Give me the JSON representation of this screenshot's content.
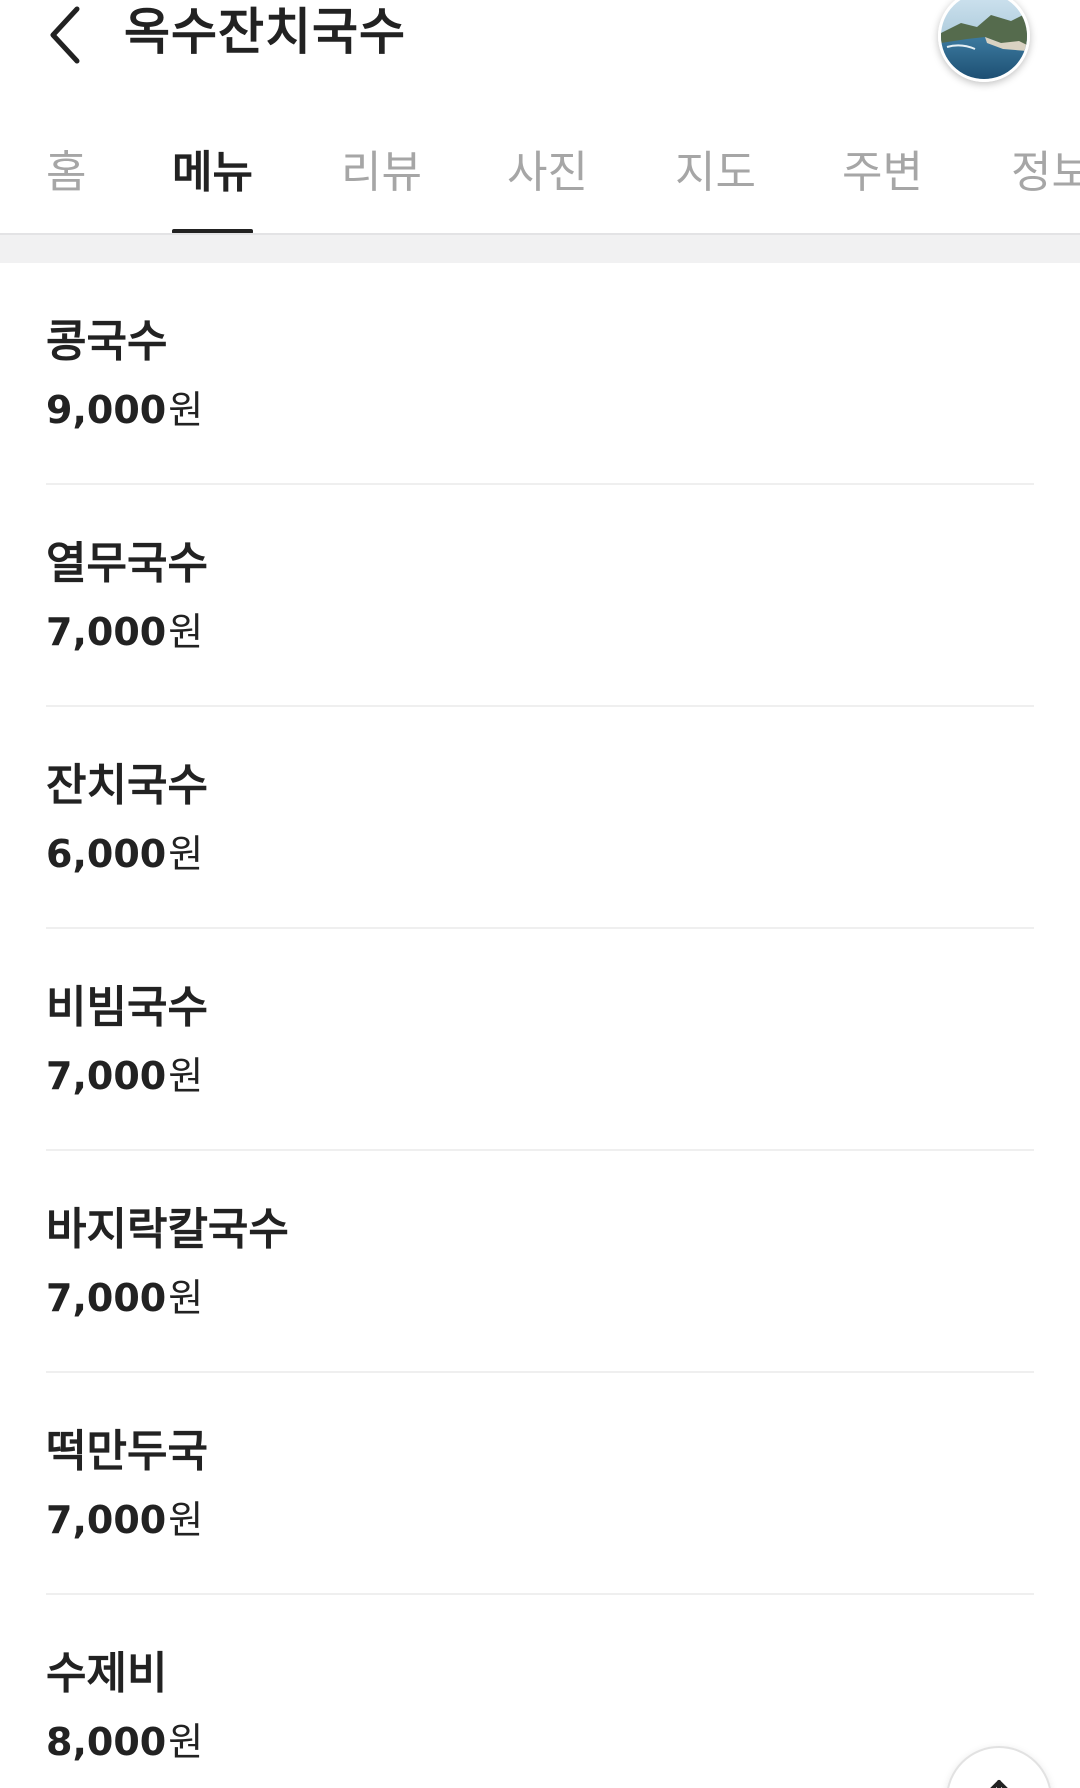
{
  "header": {
    "title": "옥수잔치국수",
    "back_icon": "chevron-left-icon",
    "avatar_icon": "profile-photo-coast"
  },
  "tabs": [
    {
      "label": "홈",
      "active": false
    },
    {
      "label": "메뉴",
      "active": true
    },
    {
      "label": "리뷰",
      "active": false
    },
    {
      "label": "사진",
      "active": false
    },
    {
      "label": "지도",
      "active": false
    },
    {
      "label": "주변",
      "active": false
    },
    {
      "label": "정보",
      "active": false
    }
  ],
  "menu": {
    "items": [
      {
        "name": "콩국수",
        "price": "9,000",
        "unit": "원"
      },
      {
        "name": "열무국수",
        "price": "7,000",
        "unit": "원"
      },
      {
        "name": "잔치국수",
        "price": "6,000",
        "unit": "원"
      },
      {
        "name": "비빔국수",
        "price": "7,000",
        "unit": "원"
      },
      {
        "name": "바지락칼국수",
        "price": "7,000",
        "unit": "원"
      },
      {
        "name": "떡만두국",
        "price": "7,000",
        "unit": "원"
      },
      {
        "name": "수제비",
        "price": "8,000",
        "unit": "원"
      }
    ]
  },
  "scroll_top": {
    "icon": "arrow-up-icon"
  },
  "colors": {
    "text_primary": "#222222",
    "text_inactive": "#a6a6a6",
    "divider": "#efefef",
    "section_gap": "#f1f1f2"
  }
}
